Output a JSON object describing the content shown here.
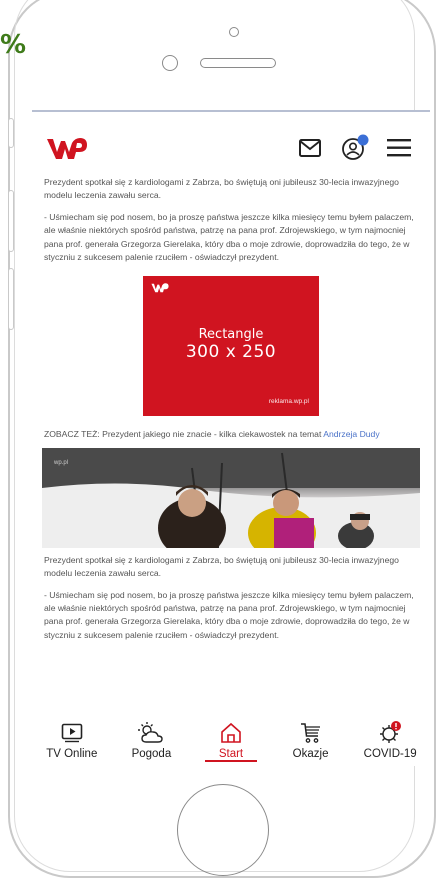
{
  "overlay": {
    "percent_glyph": "%"
  },
  "header": {
    "logo": "WP",
    "icons": [
      "mail-icon",
      "user-notification-icon",
      "hamburger-menu-icon"
    ],
    "brand_color": "#d01420"
  },
  "article": {
    "p1": "Prezydent spotkał się z kardiologami z Zabrza, bo świętują oni jubileusz 30-lecia inwazyjnego modelu leczenia zawału serca.",
    "p2": "- Uśmiecham się pod nosem, bo ja proszę państwa jeszcze kilka miesięcy temu byłem palaczem, ale właśnie niektórych spośród państwa, patrzę na pana prof. Zdrojewskiego, w tym najmocniej pana prof. generała Grzegorza Gierelaka, który dba o moje zdrowie, doprowadziła do tego, że w styczniu z sukcesem palenie rzuciłem - oświadczył prezydent.",
    "ad": {
      "logo": "WP",
      "line1": "Rectangle",
      "line2": "300 x 250",
      "footer": "reklama.wp.pl"
    },
    "zobacz_prefix": "ZOBACZ TEŻ: Prezydent jakiego nie znacie - kilka ciekawostek na temat ",
    "zobacz_link": "Andrzeja Dudy",
    "photo_caption_small": "wp.pl",
    "p3": "Prezydent spotkał się z kardiologami z Zabrza, bo świętują oni jubileusz 30-lecia inwazyjnego modelu leczenia zawału serca.",
    "p4": "- Uśmiecham się pod nosem, bo ja proszę państwa jeszcze kilka miesięcy temu byłem palaczem, ale właśnie niektórych spośród państwa, patrzę na pana prof. Zdrojewskiego, w tym najmocniej pana prof. generała Grzegorza Gierelaka, który dba o moje zdrowie, doprowadziła do tego, że w styczniu z sukcesem palenie rzuciłem - oświadczył prezydent."
  },
  "bottom_nav": {
    "items": [
      {
        "label": "TV Online",
        "icon": "play-icon"
      },
      {
        "label": "Pogoda",
        "icon": "weather-icon"
      },
      {
        "label": "Start",
        "icon": "home-icon",
        "active": true
      },
      {
        "label": "Okazje",
        "icon": "cart-icon"
      },
      {
        "label": "COVID-19",
        "icon": "virus-icon"
      }
    ],
    "active_color": "#d01420"
  }
}
